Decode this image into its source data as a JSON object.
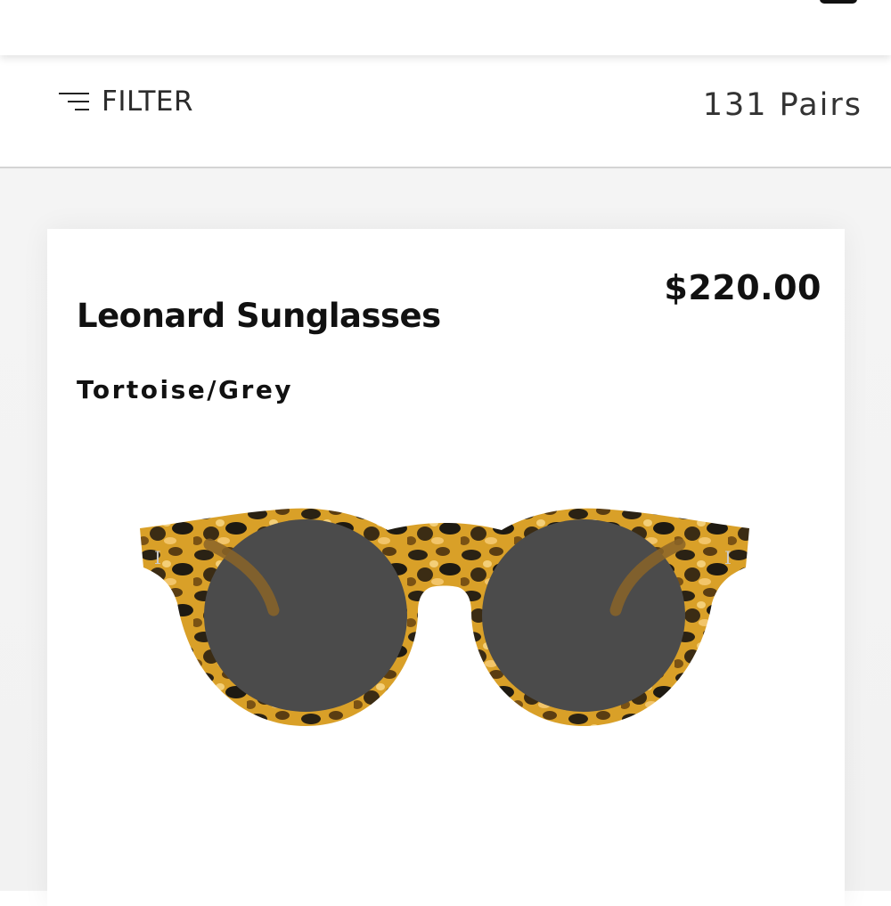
{
  "header": {
    "icon": "menu-icon"
  },
  "filter_bar": {
    "filter_label": "FILTER",
    "filter_icon": "filter-lines-icon",
    "count_label": "131 Pairs"
  },
  "product": {
    "name": "Leonard Sunglasses",
    "price": "$220.00",
    "color": "Tortoise/Grey",
    "image": "tortoise-round-sunglasses",
    "colors": {
      "frame_light": "#d9a028",
      "frame_dark": "#1e1a12",
      "lens": "#4a4a4a"
    }
  }
}
